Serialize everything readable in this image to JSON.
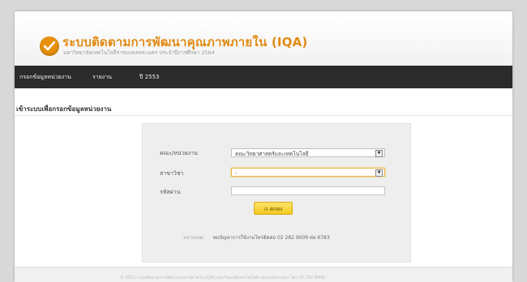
{
  "header": {
    "title": "ระบบติดตามการพัฒนาคุณภาพภายใน (IQA)",
    "subtitle": "มหาวิทยาลัยเทคโนโลยีราชมงคลพระนคร ประจำปีการศึกษา 2564",
    "logo_icon": "check-icon",
    "accent_color": "#e08b12"
  },
  "nav": {
    "items": [
      {
        "label": "กรอกข้อมูลหน่วยงาน"
      },
      {
        "label": "รายงาน"
      },
      {
        "label": "ปี 2553"
      }
    ]
  },
  "main": {
    "heading": "เข้าระบบเพื่อกรอกข้อมูลหน่วยงาน"
  },
  "form": {
    "faculty_label": "คณะ/หน่วยงาน",
    "faculty_value": "คณะวิทยาศาสตร์และเทคโนโลยี",
    "program_label": "สาขาวิชา",
    "program_value": "-",
    "password_label": "รหัสผ่าน",
    "password_value": "",
    "submit_label": "ตกลง",
    "note_prefix": "หมายเหตุ",
    "note_text": "พบปัญหาการใช้งานโทรติดต่อ 02 282 9009 ต่อ 6783"
  },
  "footer": {
    "text": "© 2011 ระบบติดตามการพัฒนาคุณภาพภายใน (IQA) มหาวิทยาลัยเทคโนโลยีราชมงคลพระนคร โทร 02 282 9009"
  }
}
